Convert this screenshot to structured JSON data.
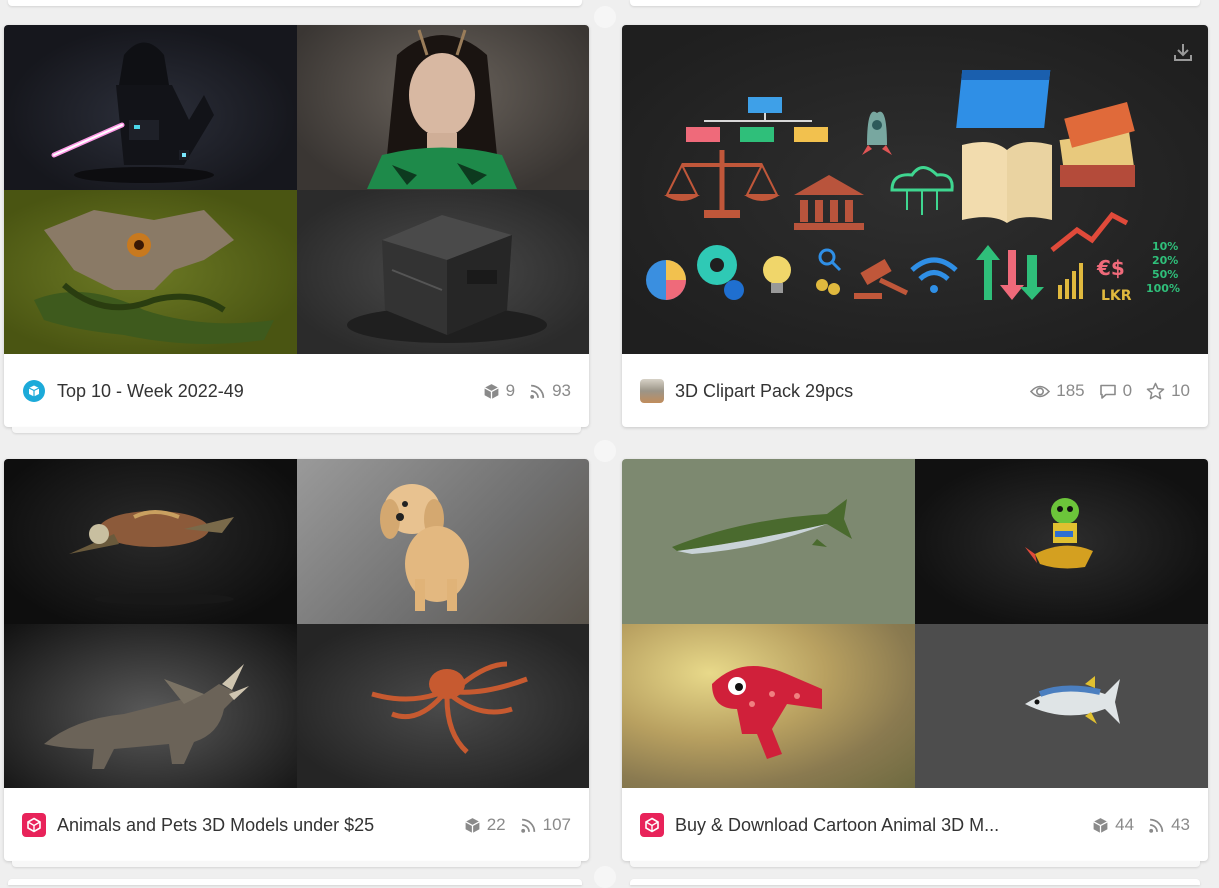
{
  "collections": [
    {
      "title": "Top 10 - Week 2022-49",
      "avatar_icon": "sketchfab-logo-icon",
      "stats": [
        {
          "icon": "models-cube-icon",
          "value": "9"
        },
        {
          "icon": "followers-rss-icon",
          "value": "93"
        }
      ],
      "thumbnails": [
        "sith-lord-figure",
        "woman-with-antennae",
        "dragon-skull-creature",
        "metal-crate"
      ]
    },
    {
      "title": "3D Clipart Pack 29pcs",
      "avatar_icon": "user-avatar-photo",
      "download_icon": "download-icon",
      "stats": [
        {
          "icon": "eye-icon",
          "value": "185"
        },
        {
          "icon": "comment-icon",
          "value": "0"
        },
        {
          "icon": "star-icon",
          "value": "10"
        }
      ],
      "thumbnails": [
        "clipart-pack-preview"
      ],
      "clipart_labels": {
        "currency": "€$",
        "code": "LKR",
        "pcts": [
          "10%",
          "20%",
          "50%",
          "100%"
        ]
      }
    },
    {
      "title": "Animals and Pets 3D Models under $25",
      "avatar_icon": "cgtrader-logo-icon",
      "stats": [
        {
          "icon": "models-cube-icon",
          "value": "22"
        },
        {
          "icon": "followers-rss-icon",
          "value": "107"
        }
      ],
      "thumbnails": [
        "sea-turtle",
        "cocker-spaniel",
        "triceratops",
        "octopus"
      ]
    },
    {
      "title": "Buy & Download Cartoon Animal 3D M...",
      "avatar_icon": "cgtrader-logo-icon",
      "stats": [
        {
          "icon": "models-cube-icon",
          "value": "44"
        },
        {
          "icon": "followers-rss-icon",
          "value": "43"
        }
      ],
      "thumbnails": [
        "barracuda-fish",
        "alien-on-rocket",
        "red-cartoon-dino",
        "tuna-fish"
      ]
    }
  ]
}
